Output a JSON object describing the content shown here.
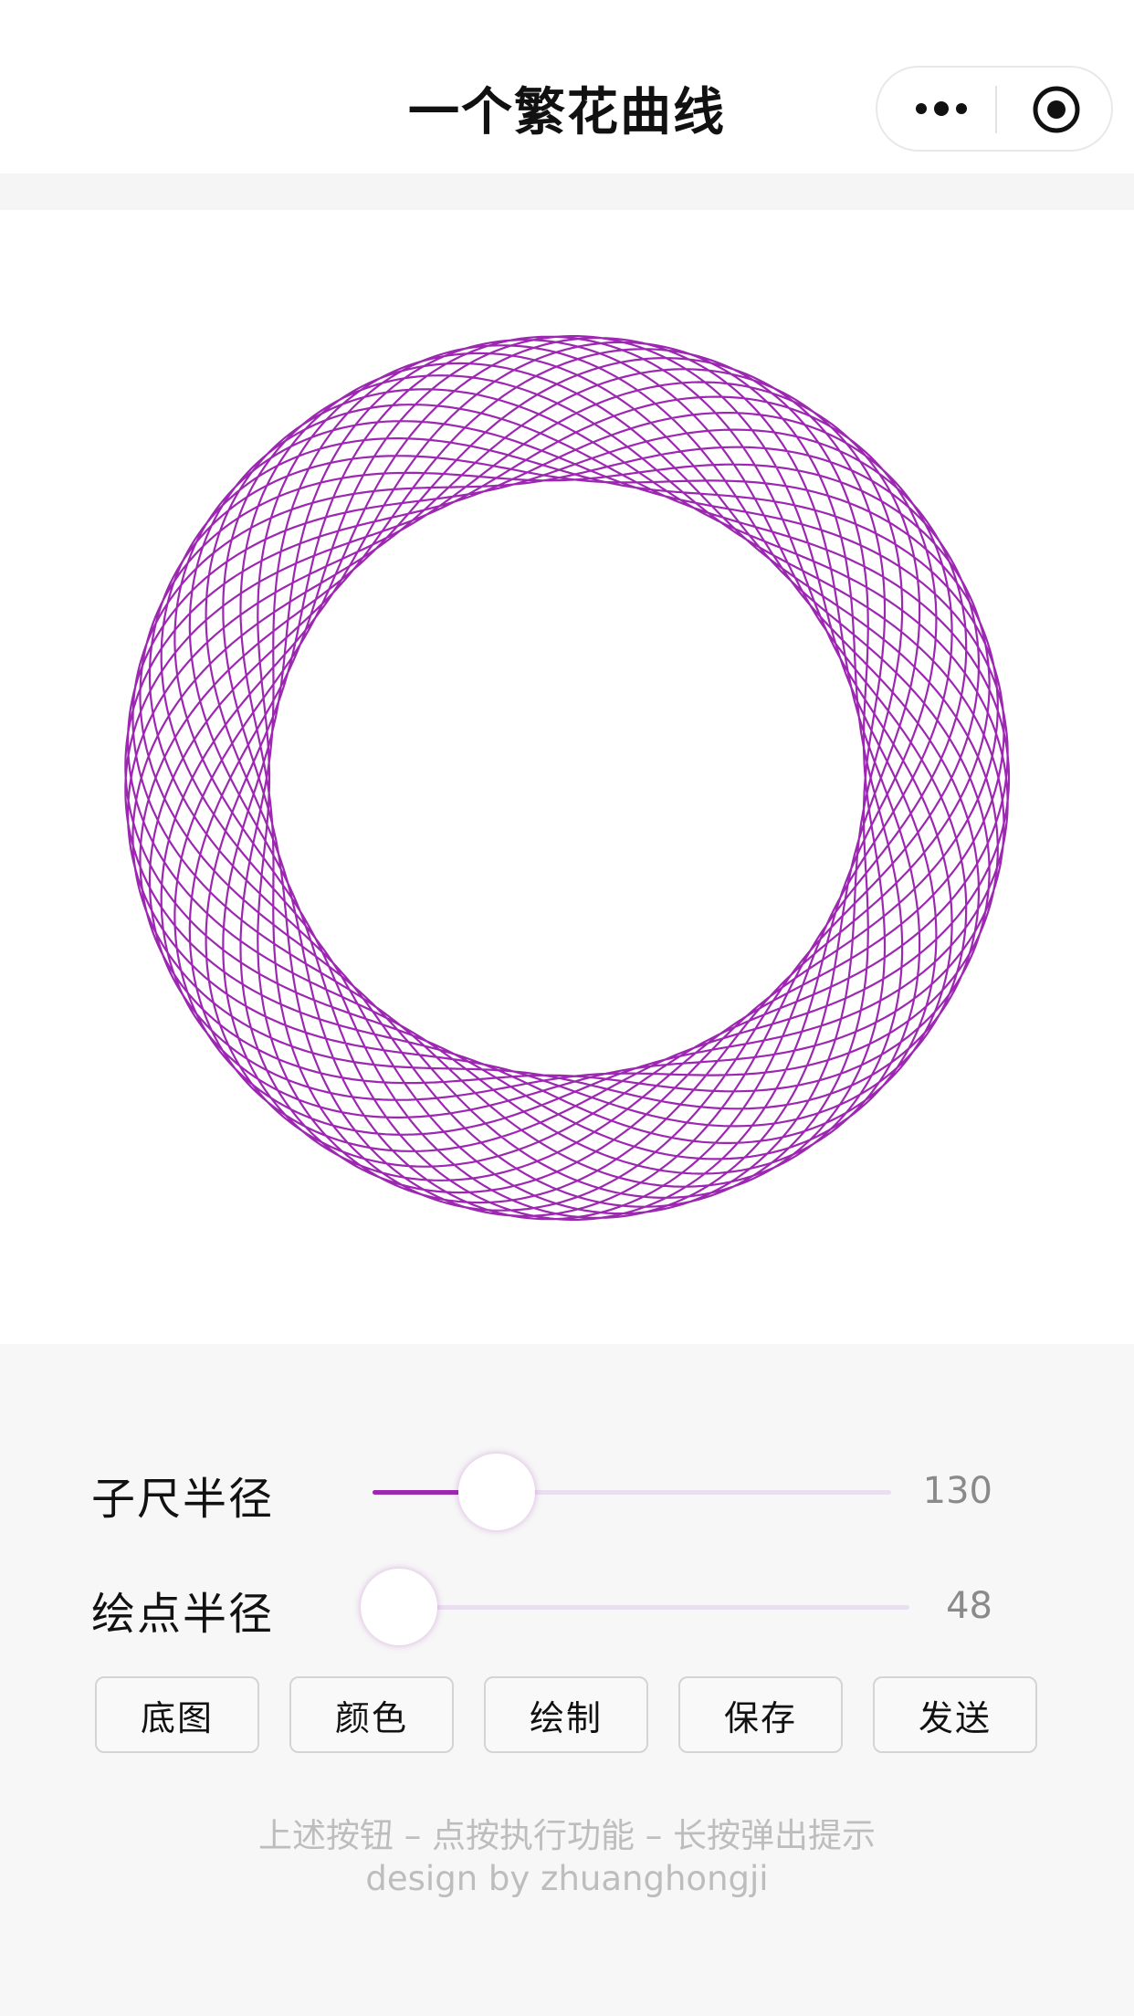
{
  "nav": {
    "title": "一个繁花曲线",
    "more_icon": "more-dots-icon",
    "close_icon": "target-circle-icon"
  },
  "spirograph": {
    "color": "#9c27b0",
    "sub_radius": 130,
    "pen_radius": 48
  },
  "sliders": [
    {
      "label": "子尺半径",
      "value": "130",
      "fraction": 0.24
    },
    {
      "label": "绘点半径",
      "value": "48",
      "fraction": 0.05
    }
  ],
  "buttons": [
    {
      "label": "底图"
    },
    {
      "label": "颜色"
    },
    {
      "label": "绘制"
    },
    {
      "label": "保存"
    },
    {
      "label": "发送"
    }
  ],
  "footer": {
    "hint": "上述按钮 – 点按执行功能 – 长按弹出提示",
    "credit": "design by zhuanghongji"
  }
}
